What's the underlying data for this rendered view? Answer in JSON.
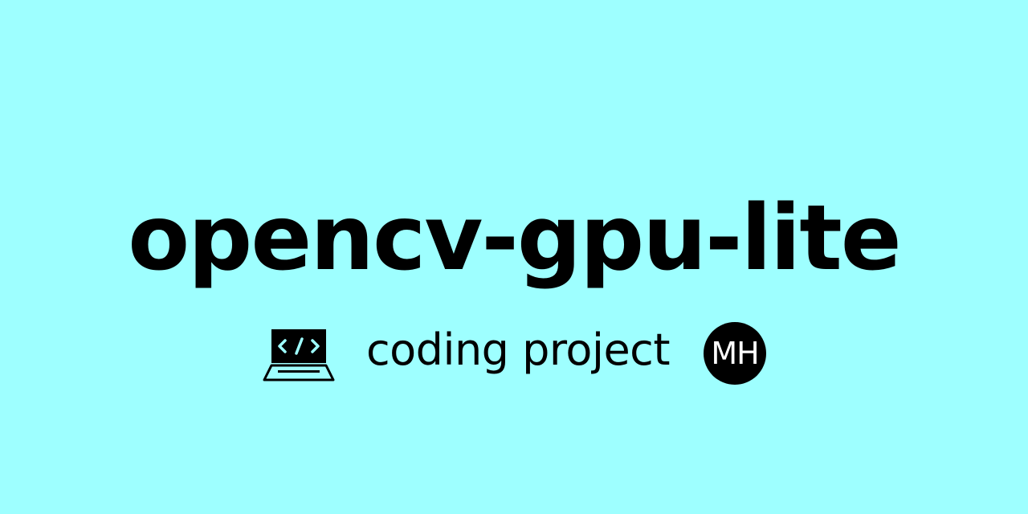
{
  "banner": {
    "title": "opencv-gpu-lite",
    "tagline": "coding project",
    "avatar_initials": "MH",
    "laptop_icon": "laptop-code-icon",
    "colors": {
      "background": "#9effff",
      "text": "#000000",
      "avatar_background": "#000000",
      "avatar_text": "#ffffff"
    }
  }
}
